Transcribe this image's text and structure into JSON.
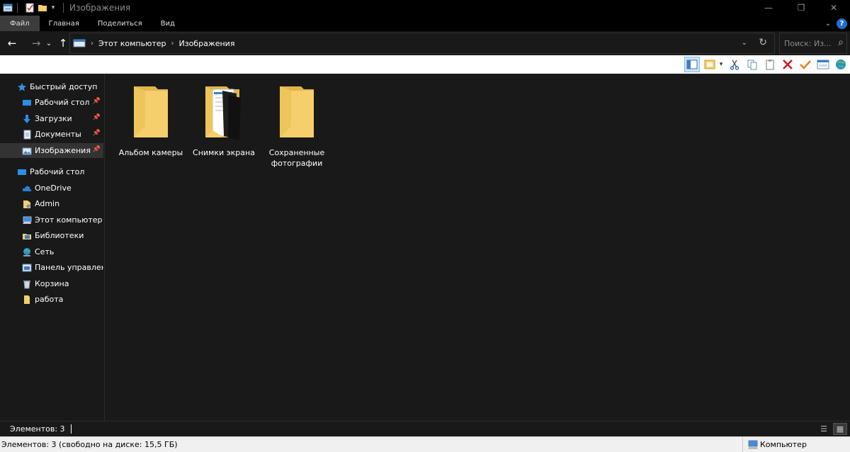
{
  "window": {
    "title": "Изображения",
    "min_glyph": "—",
    "restore_glyph": "❐",
    "close_glyph": "✕"
  },
  "ribbon": {
    "tabs": [
      "Файл",
      "Главная",
      "Поделиться",
      "Вид"
    ],
    "help_glyph": "?"
  },
  "nav": {
    "breadcrumb": [
      "Этот компьютер",
      "Изображения"
    ],
    "search_placeholder": "Поиск: Из..."
  },
  "sidebar": {
    "items": [
      {
        "label": "Быстрый доступ"
      },
      {
        "label": "Рабочий стол"
      },
      {
        "label": "Загрузки"
      },
      {
        "label": "Документы"
      },
      {
        "label": "Изображения"
      },
      {
        "label": "Рабочий стол"
      },
      {
        "label": "OneDrive"
      },
      {
        "label": "Admin"
      },
      {
        "label": "Этот компьютер"
      },
      {
        "label": "Библиотеки"
      },
      {
        "label": "Сеть"
      },
      {
        "label": "Панель управления"
      },
      {
        "label": "Корзина"
      },
      {
        "label": "работа"
      }
    ]
  },
  "content": {
    "folders": [
      {
        "label": "Альбом камеры"
      },
      {
        "label": "Снимки экрана"
      },
      {
        "label": "Сохраненные фотографии"
      }
    ]
  },
  "status": {
    "items_count": "Элементов: 3",
    "disk_info": "Элементов: 3 (свободно на диске: 15,5 ГБ)",
    "location": "Компьютер"
  },
  "colors": {
    "folder": "#f5cf6b",
    "folder_dark": "#e3b548",
    "accent": "#1e6fd0",
    "selection": "#333333"
  }
}
